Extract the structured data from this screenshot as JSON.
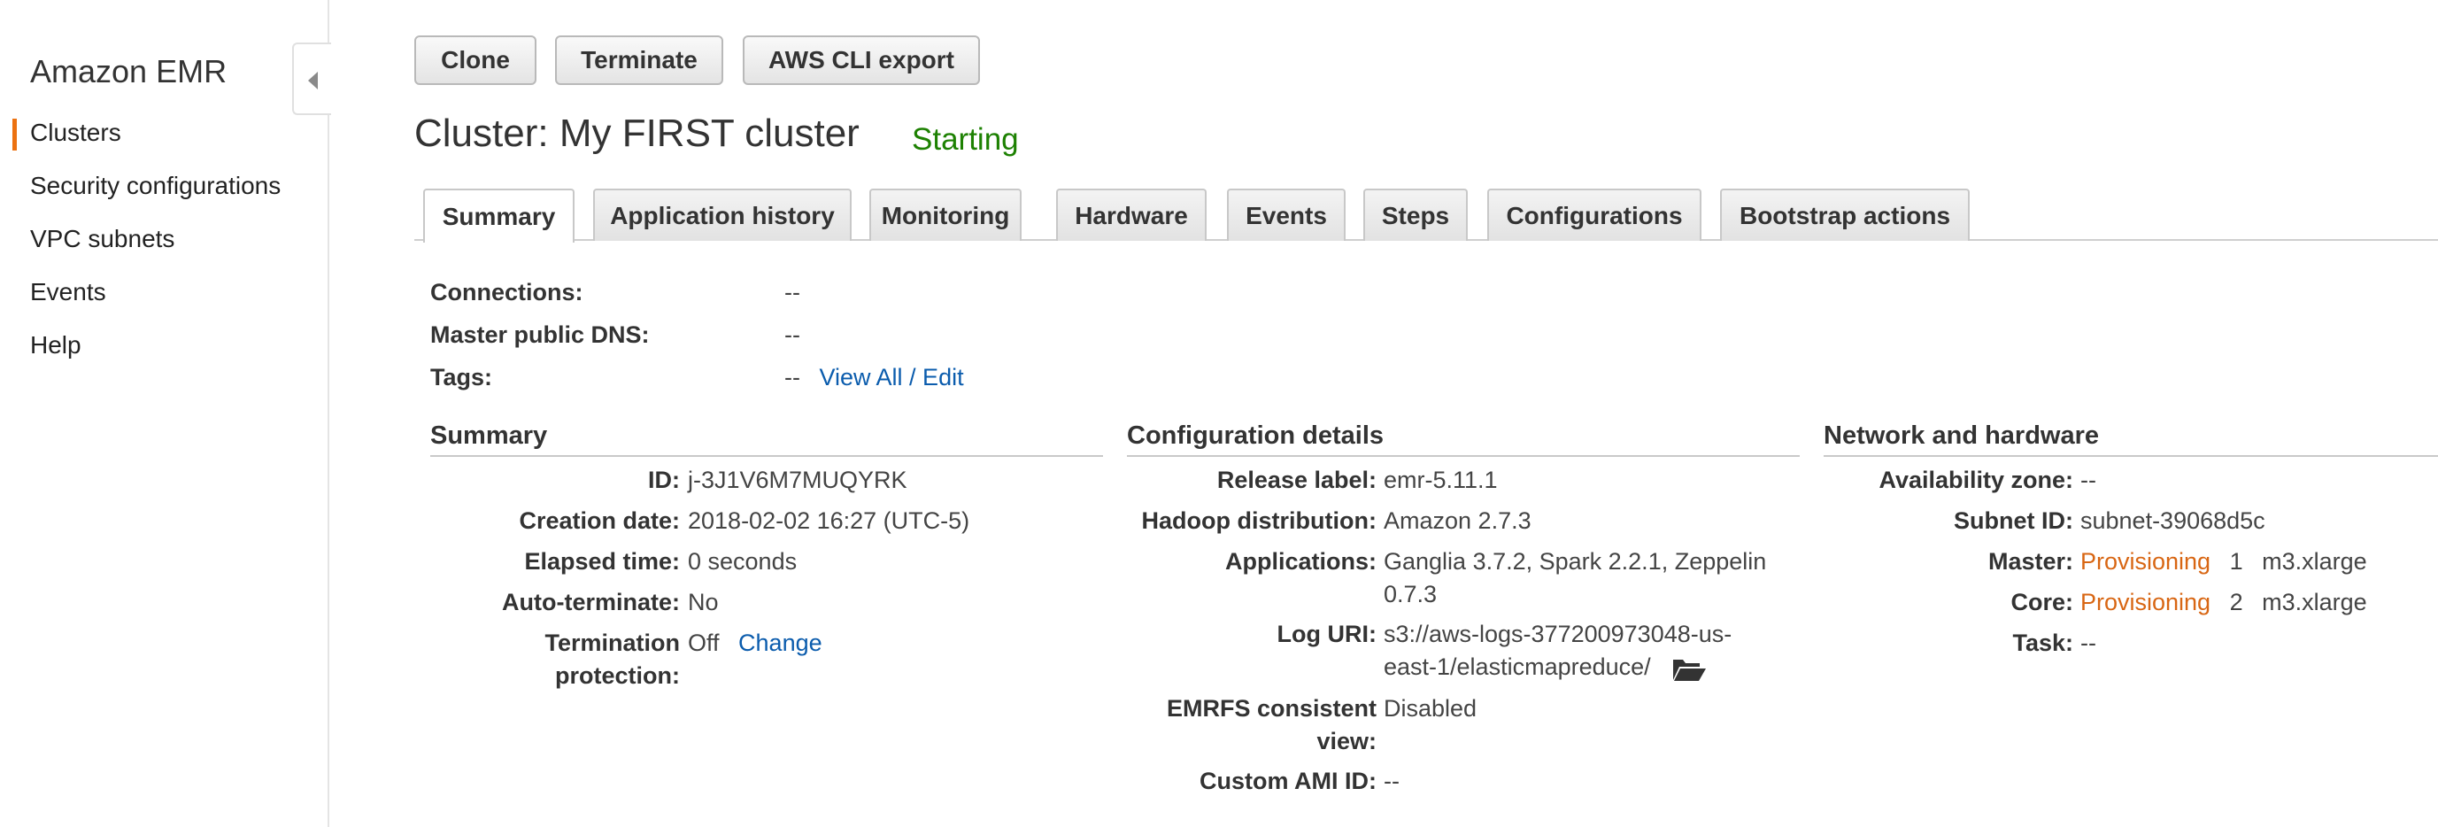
{
  "sidebar": {
    "title": "Amazon EMR",
    "items": [
      {
        "label": "Clusters"
      },
      {
        "label": "Security configurations"
      },
      {
        "label": "VPC subnets"
      },
      {
        "label": "Events"
      },
      {
        "label": "Help"
      }
    ],
    "active_index": 0,
    "collapse_icon": "chevron-left-icon"
  },
  "toolbar": {
    "clone": "Clone",
    "terminate": "Terminate",
    "cli_export": "AWS CLI export"
  },
  "cluster": {
    "title": "Cluster: My FIRST cluster",
    "status": "Starting"
  },
  "tabs": [
    {
      "label": "Summary"
    },
    {
      "label": "Application history"
    },
    {
      "label": "Monitoring"
    },
    {
      "label": "Hardware"
    },
    {
      "label": "Events"
    },
    {
      "label": "Steps"
    },
    {
      "label": "Configurations"
    },
    {
      "label": "Bootstrap actions"
    }
  ],
  "active_tab": 0,
  "overview": {
    "connections": {
      "label": "Connections:",
      "value": "--"
    },
    "master_dns": {
      "label": "Master public DNS:",
      "value": "--"
    },
    "tags": {
      "label": "Tags:",
      "value": "--",
      "link": "View All / Edit"
    }
  },
  "summary": {
    "heading": "Summary",
    "id": {
      "label": "ID:",
      "value": "j-3J1V6M7MUQYRK"
    },
    "creation_date": {
      "label": "Creation date:",
      "value": "2018-02-02 16:27 (UTC-5)"
    },
    "elapsed": {
      "label": "Elapsed time:",
      "value": "0 seconds"
    },
    "auto_terminate": {
      "label": "Auto-terminate:",
      "value": "No"
    },
    "termination_protection": {
      "label_line1": "Termination",
      "label_line2": "protection:",
      "value": "Off",
      "link": "Change"
    }
  },
  "configuration": {
    "heading": "Configuration details",
    "release": {
      "label": "Release label:",
      "value": "emr-5.11.1"
    },
    "hadoop": {
      "label": "Hadoop distribution:",
      "value": "Amazon 2.7.3"
    },
    "applications": {
      "label": "Applications:",
      "value_line1": "Ganglia 3.7.2, Spark 2.2.1, Zeppelin",
      "value_line2": "0.7.3"
    },
    "log_uri": {
      "label": "Log URI:",
      "value_line1": "s3://aws-logs-377200973048-us-",
      "value_line2": "east-1/elasticmapreduce/",
      "icon": "folder-open-icon"
    },
    "emrfs": {
      "label_line1": "EMRFS consistent",
      "label_line2": "view:",
      "value": "Disabled"
    },
    "custom_ami": {
      "label": "Custom AMI ID:",
      "value": "--"
    }
  },
  "network": {
    "heading": "Network and hardware",
    "az": {
      "label": "Availability zone:",
      "value": "--"
    },
    "subnet": {
      "label": "Subnet ID:",
      "value": "subnet-39068d5c"
    },
    "master": {
      "label": "Master:",
      "status": "Provisioning",
      "count": "1",
      "type": "m3.xlarge"
    },
    "core": {
      "label": "Core:",
      "status": "Provisioning",
      "count": "2",
      "type": "m3.xlarge"
    },
    "task": {
      "label": "Task:",
      "value": "--"
    }
  },
  "colors": {
    "accent": "#ec7211",
    "status_green": "#1d8102",
    "link_blue": "#0b5cad",
    "provisioning_orange": "#d86613"
  }
}
